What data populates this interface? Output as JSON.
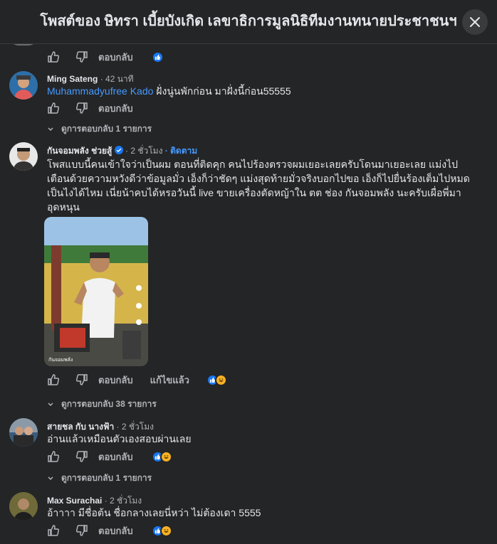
{
  "header": {
    "title": "โพสต์ของ ษิทรา เบี้ยบังเกิด เลขาธิการมูลนิธิทีมงานทนายประชาชนฯ"
  },
  "actions": {
    "reply_label": "ตอบกลับ",
    "edited_label": "แก้ไขแล้ว"
  },
  "comments": [
    {
      "author": "Ming Sateng",
      "time": "· 42 นาที",
      "mention": "Muhammadyufree Kado",
      "text": " ฝั่งนู่นพักก่อน มาฝั่งนี้ก่อน55555",
      "replies_link": "ดูการตอบกลับ 1 รายการ"
    },
    {
      "author": "กันจอมพลัง ช่วยสู้",
      "time": "· 2 ชั่วโมง",
      "follow": "· ติดตาม",
      "text": "โพสแบบนี้คนเข้าใจว่าเป็นผม ตอนที่ติดคุก คนไปร้องตรวจผมเยอะเลยครับโดนมาเยอะเลย แม่งไปเตือนด้วยความหวังดีว่าข้อมูลมั่ว เอ็งก็ว่าชัดๆ แม่งสุดท้ายมั่วจริงบอกไปขอ เอ็งก็ไปยื่นร้องเต็มไปหมดเป็นไงได้ไหม เนี่ยน้าคบได้หรอวันนี้ live ขายเครื่องตัดหญ้าใน ตต ช่อง กันจอมพลัง นะครับเผื่อพี่มาอุดหนุน",
      "image_caption": "กันจอมพลัง",
      "replies_link": "ดูการตอบกลับ 38 รายการ"
    },
    {
      "author": "สายชล กับ นางฟ้า",
      "time": "· 2 ชั่วโมง",
      "text": "อ่านแล้วเหมือนตัวเองสอบผ่านเลย",
      "replies_link": "ดูการตอบกลับ 1 รายการ"
    },
    {
      "author": "Max Surachai",
      "time": "· 2 ชั่วโมง",
      "text": "อ้าาาา มีชื่อต้น ชื่อกลางเลยนี่หว่า ไม่ต้องเดา 5555"
    }
  ],
  "colors": {
    "background": "#242526",
    "link": "#4599ff",
    "like": "#1877f2",
    "haha": "#f7b125"
  },
  "icons": [
    "close-icon",
    "like-icon",
    "dislike-icon",
    "chevron-down-icon",
    "verified-badge-icon",
    "like-reaction-icon",
    "haha-reaction-icon"
  ]
}
